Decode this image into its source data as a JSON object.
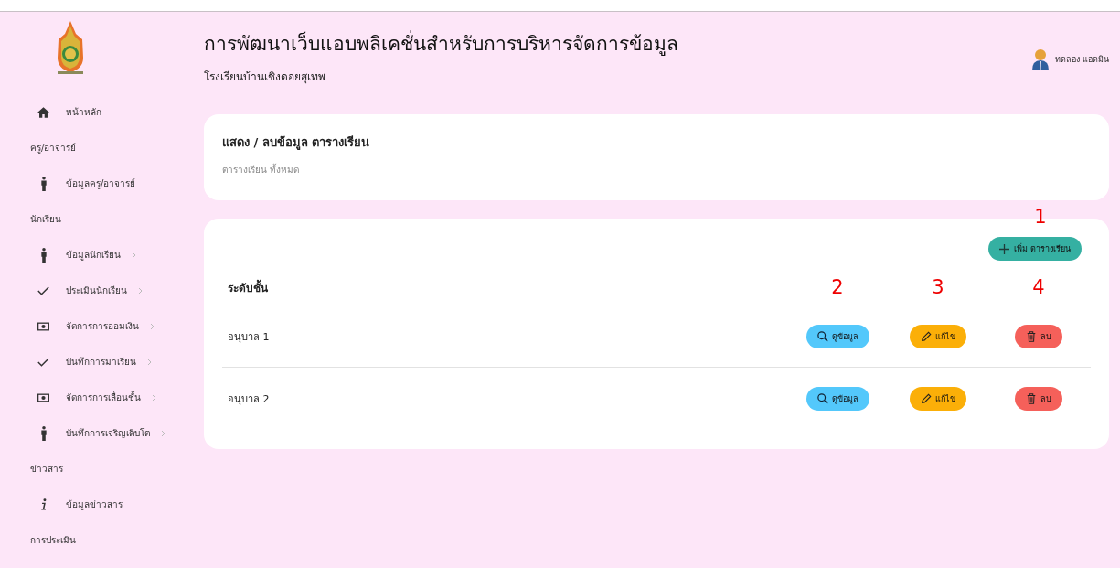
{
  "header": {
    "title": "การพัฒนาเว็บแอบพลิเคชั่นสำหรับการบริหารจัดการข้อมูล",
    "subtitle": "โรงเรียนบ้านเชิงดอยสุเทพ",
    "user": "ทดลอง แอดมิน"
  },
  "sidebar": {
    "items": [
      {
        "kind": "home",
        "label": "หน้าหลัก",
        "has_submenu": false
      },
      {
        "kind": "section",
        "label": "ครู/อาจารย์"
      },
      {
        "kind": "person",
        "label": "ข้อมูลครู/อาจารย์",
        "has_submenu": false
      },
      {
        "kind": "section",
        "label": "นักเรียน"
      },
      {
        "kind": "person",
        "label": "ข้อมูลนักเรียน",
        "has_submenu": true
      },
      {
        "kind": "check",
        "label": "ประเมินนักเรียน",
        "has_submenu": true
      },
      {
        "kind": "money",
        "label": "จัดการการออมเงิน",
        "has_submenu": true
      },
      {
        "kind": "check",
        "label": "บันทึกการมาเรียน",
        "has_submenu": true
      },
      {
        "kind": "money",
        "label": "จัดการการเลื่อนชั้น",
        "has_submenu": true
      },
      {
        "kind": "person",
        "label": "บันทึกการเจริญเติบโต",
        "has_submenu": true
      },
      {
        "kind": "section",
        "label": "ข่าวสาร"
      },
      {
        "kind": "info",
        "label": "ข้อมูลข่าวสาร",
        "has_submenu": false
      },
      {
        "kind": "section",
        "label": "การประเมิน"
      }
    ]
  },
  "info_card": {
    "title": "แสดง / ลบข้อมูล ตารางเรียน",
    "subtitle": "ตารางเรียน ทั้งหมด"
  },
  "table": {
    "add_button": "เพิ่ม ตารางเรียน",
    "add_annotation": "1",
    "columns": [
      {
        "label": "ระดับชั้น"
      }
    ],
    "action_annotations": [
      "2",
      "3",
      "4"
    ],
    "rows": [
      {
        "level": "อนุบาล 1",
        "actions": [
          {
            "kind": "view",
            "label": "ดูข้อมูล"
          },
          {
            "kind": "edit",
            "label": "แก้ไข"
          },
          {
            "kind": "delete",
            "label": "ลบ"
          }
        ]
      },
      {
        "level": "อนุบาล 2",
        "actions": [
          {
            "kind": "view",
            "label": "ดูข้อมูล"
          },
          {
            "kind": "edit",
            "label": "แก้ไข"
          },
          {
            "kind": "delete",
            "label": "ลบ"
          }
        ]
      }
    ]
  }
}
